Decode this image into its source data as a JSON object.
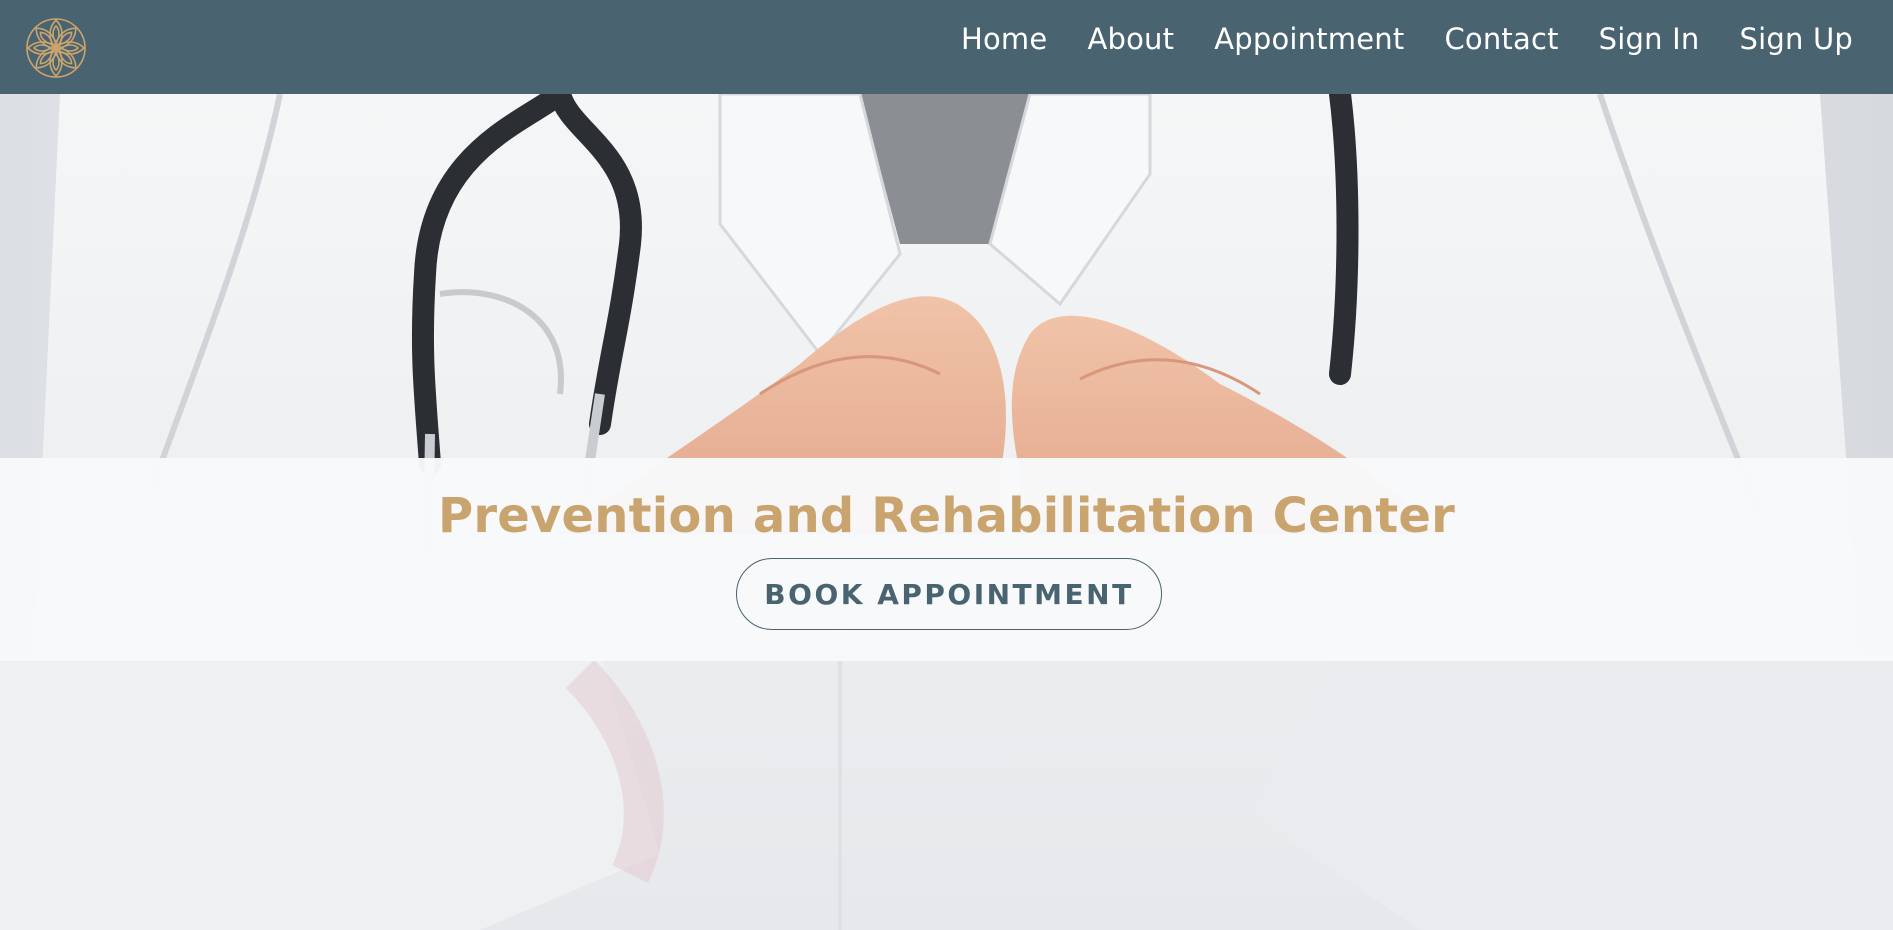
{
  "colors": {
    "navbar_bg": "#4a6370",
    "accent_gold": "#c9a46f",
    "button_text": "#4a6370",
    "banner_bg": "#f8f9fa"
  },
  "brand": {
    "logo_icon": "mandala-flower-icon"
  },
  "nav": {
    "items": [
      {
        "label": "Home"
      },
      {
        "label": "About"
      },
      {
        "label": "Appointment"
      },
      {
        "label": "Contact"
      },
      {
        "label": "Sign In"
      },
      {
        "label": "Sign Up"
      }
    ]
  },
  "hero": {
    "title": "Prevention and Rehabilitation Center",
    "cta_label": "BOOK APPOINTMENT",
    "image_subject": "doctor-heart-hands-photo"
  }
}
